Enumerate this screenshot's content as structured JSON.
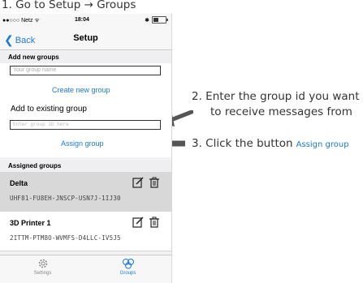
{
  "annotations": {
    "step1": "1.  Go to Setup → Groups",
    "step2_line1": "2.  Enter the group id you want",
    "step2_line2": "to receive messages from",
    "step3": "3.  Click the button",
    "step3_link": "Assign group"
  },
  "statusbar": {
    "carrier": "●●○○○ Netz ᯤ",
    "time": "18:04",
    "bluetooth": "✱"
  },
  "navbar": {
    "back_label": "Back",
    "title": "Setup"
  },
  "add_new": {
    "header": "Add new groups",
    "placeholder": "Your group name",
    "create_label": "Create new group"
  },
  "add_existing": {
    "label": "Add to existing group",
    "placeholder": "Enter group ID here",
    "assign_label": "Assign group"
  },
  "assigned": {
    "header": "Assigned groups",
    "groups": [
      {
        "name": "Delta",
        "id": "UHF81-FU8EH-JNSCP-USN7J-1IJ30"
      },
      {
        "name": "3D Printer 1",
        "id": "2ITTM-PTM8O-WVMFS-D4LLC-IV5J5"
      }
    ]
  },
  "tabbar": {
    "settings_label": "Settings",
    "groups_label": "Groups"
  },
  "colors": {
    "accent": "#1a7ad6",
    "arrow": "#555555",
    "selected_row": "#d8d8d8"
  }
}
